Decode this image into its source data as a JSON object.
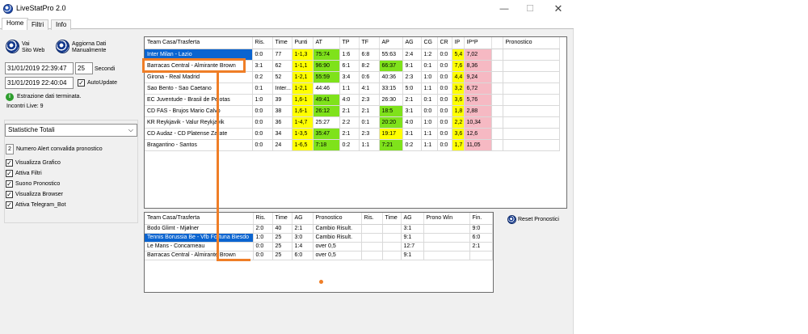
{
  "window": {
    "title": "LiveStatPro 2.0",
    "controls": {
      "minimize": "—",
      "maximize": "☐",
      "close": "✕"
    }
  },
  "tabs": [
    {
      "label": "Home",
      "active": true
    },
    {
      "label": "Filtri",
      "active": false
    },
    {
      "label": "Info",
      "active": false
    }
  ],
  "left": {
    "btn_site": "Vai\nSito Web",
    "btn_update": "Aggiorna Dati\nManualmente",
    "datetime1": "31/01/2019 22:39:47",
    "seconds_value": "25",
    "seconds_label": "Secondi",
    "datetime2": "31/01/2019 22:40:04",
    "autoupdate_label": "AutoUpdate",
    "autoupdate_checked": true,
    "status_line1": "Estrazione dati terminata.",
    "status_line2": "Incontri Live: 9",
    "stats_select": "Statistiche Totali",
    "alert_value": "2",
    "alert_label": "Numero Alert convalida pronostico",
    "checkboxes": [
      {
        "label": "Visualizza Grafico",
        "checked": true
      },
      {
        "label": "Attiva Filtri",
        "checked": true
      },
      {
        "label": "Suono Pronostico",
        "checked": true
      },
      {
        "label": "Visualizza Browser",
        "checked": true
      },
      {
        "label": "Attiva Telegram_Bot",
        "checked": true
      }
    ]
  },
  "grid1": {
    "headers": [
      "Team Casa/Trasferta",
      "Ris.",
      "Time",
      "Punti",
      "AT",
      "TP",
      "TF",
      "AP",
      "AG",
      "CG",
      "CR",
      "IP",
      "IP*P",
      "",
      "Pronostico"
    ],
    "rows": [
      [
        "Inter Milan - Lazio",
        "0:0",
        "77",
        "1-1,3",
        "75:74",
        "1:6",
        "6:8",
        "55:63",
        "2:4",
        "1:2",
        "0:0",
        "5,4",
        "7,02",
        "",
        ""
      ],
      [
        "Barracas Central - Almirante Brown",
        "3:1",
        "62",
        "1-1,1",
        "96:90",
        "6:1",
        "8:2",
        "66:37",
        "9:1",
        "0:1",
        "0:0",
        "7,6",
        "8,36",
        "",
        ""
      ],
      [
        "Girona - Real Madrid",
        "0:2",
        "52",
        "1-2,1",
        "55:59",
        "3:4",
        "0:6",
        "40:36",
        "2:3",
        "1:0",
        "0:0",
        "4,4",
        "9,24",
        "",
        ""
      ],
      [
        "Sao Bento - Sao Caetano",
        "0:1",
        "Inter...",
        "1-2,1",
        "44:46",
        "1:1",
        "4:1",
        "33:15",
        "5:0",
        "1:1",
        "0:0",
        "3,2",
        "6,72",
        "",
        ""
      ],
      [
        "EC Juventude - Brasil de Pelotas",
        "1:0",
        "39",
        "1,6-1",
        "49:41",
        "4:0",
        "2:3",
        "26:30",
        "2:1",
        "0:1",
        "0:0",
        "3,6",
        "5,76",
        "",
        ""
      ],
      [
        "CD FAS - Brujos Mario Calvo",
        "0:0",
        "38",
        "1,6-1",
        "26:12",
        "2:1",
        "2:1",
        "18:5",
        "3:1",
        "0:0",
        "0:0",
        "1,8",
        "2,88",
        "",
        ""
      ],
      [
        "KR Reykjavik - Valur Reykjavik",
        "0:0",
        "36",
        "1-4,7",
        "25:27",
        "2:2",
        "0:1",
        "20:20",
        "4:0",
        "1:0",
        "0:0",
        "2,2",
        "10,34",
        "",
        ""
      ],
      [
        "CD Audaz - CD Platense Zarate",
        "0:0",
        "34",
        "1-3,5",
        "35:47",
        "2:1",
        "2:3",
        "19:17",
        "3:1",
        "1:1",
        "0:0",
        "3,6",
        "12,6",
        "",
        ""
      ],
      [
        "Bragantino - Santos",
        "0:0",
        "24",
        "1-6,5",
        "7:18",
        "0:2",
        "1:1",
        "7:21",
        "0:2",
        "1:1",
        "0:0",
        "1,7",
        "11,05",
        "",
        ""
      ]
    ],
    "row_highlight": [
      [
        "sel",
        "",
        "",
        "y",
        "g",
        "",
        "",
        "",
        "",
        "",
        "",
        "y",
        "p",
        "",
        ""
      ],
      [
        "",
        "",
        "",
        "y",
        "g",
        "",
        "",
        "g",
        "",
        "",
        "",
        "y",
        "p",
        "",
        ""
      ],
      [
        "",
        "",
        "",
        "y",
        "g",
        "",
        "",
        "",
        "",
        "",
        "",
        "y",
        "p",
        "",
        ""
      ],
      [
        "",
        "",
        "",
        "y",
        "",
        "",
        "",
        "",
        "",
        "",
        "",
        "y",
        "p",
        "",
        ""
      ],
      [
        "",
        "",
        "",
        "y",
        "g",
        "",
        "",
        "",
        "",
        "",
        "",
        "y",
        "p",
        "",
        ""
      ],
      [
        "",
        "",
        "",
        "y",
        "g",
        "",
        "",
        "g",
        "",
        "",
        "",
        "y",
        "p",
        "",
        ""
      ],
      [
        "",
        "",
        "",
        "y",
        "",
        "",
        "",
        "g",
        "",
        "",
        "",
        "y",
        "p",
        "",
        ""
      ],
      [
        "",
        "",
        "",
        "y",
        "g",
        "",
        "",
        "y",
        "",
        "",
        "",
        "y",
        "p",
        "",
        ""
      ],
      [
        "",
        "",
        "",
        "y",
        "g",
        "",
        "",
        "g",
        "",
        "",
        "",
        "y",
        "p",
        "",
        ""
      ]
    ]
  },
  "grid2": {
    "headers": [
      "Team Casa/Trasferta",
      "Ris.",
      "Time",
      "AG",
      "Pronostico",
      "Ris.",
      "Time",
      "AG",
      "Prono Win",
      "Fin."
    ],
    "rows": [
      [
        "Bodo Glimt - Mjølner",
        "2:0",
        "40",
        "2:1",
        "Cambio Risult.",
        "",
        "",
        "3:1",
        "",
        "9:0"
      ],
      [
        "Tennis Borussia Be - Vfb Fortuna Biesdo",
        "1:0",
        "25",
        "3:0",
        "Cambio Risult.",
        "",
        "",
        "9:1",
        "",
        "6:0"
      ],
      [
        "Le Mans - Concarneau",
        "0:0",
        "25",
        "1:4",
        "over 0,5",
        "",
        "",
        "12:7",
        "",
        "2:1"
      ],
      [
        "Barracas Central - Almirante Brown",
        "0:0",
        "25",
        "6:0",
        "over 0,5",
        "",
        "",
        "9:1",
        "",
        ""
      ]
    ]
  },
  "reset_label": "Reset Pronostici",
  "annotation_color": "#ef7e27"
}
